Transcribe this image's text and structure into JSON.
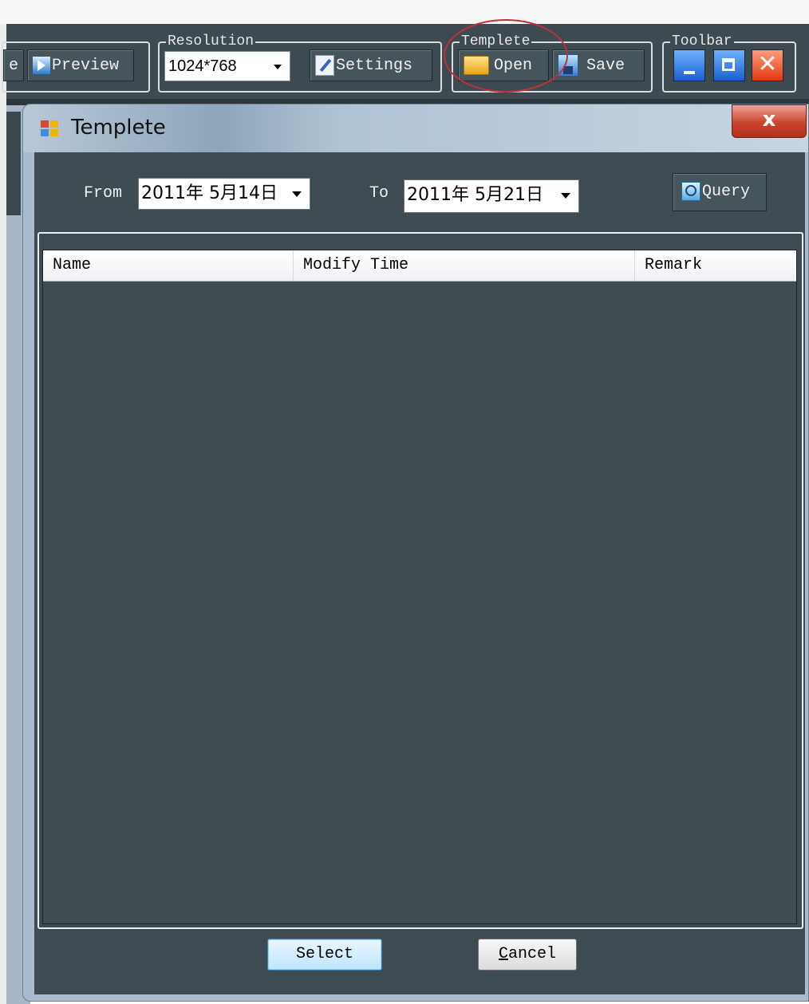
{
  "toolbar": {
    "partial_label": "e",
    "preview_label": "Preview",
    "resolution": {
      "title": "Resolution",
      "selected": "1024*768",
      "settings_label": "Settings"
    },
    "template": {
      "title": "Templete",
      "open_label": "Open",
      "save_label": "Save"
    },
    "toolbar_group": {
      "title": "Toolbar",
      "close_glyph": "✕"
    }
  },
  "dialog": {
    "title": "Templete",
    "close_glyph": "x",
    "from_label": "From",
    "from_date": "2011年 5月14日",
    "to_label": "To",
    "to_date": "2011年 5月21日",
    "query_label": "Query",
    "columns": [
      "Name",
      "Modify Time",
      "Remark"
    ],
    "rows": [],
    "select_label": "Select",
    "cancel_label": "Cancel"
  },
  "colors": {
    "toolbar_bg": "#3d4a52",
    "dialog_body_bg": "#3f4b53",
    "highlight_ring": "#c0303a",
    "close_button": "#c9442e"
  },
  "icons": [
    "preview-icon",
    "settings-icon",
    "folder-open-icon",
    "save-icon",
    "minimize-icon",
    "maximize-icon",
    "close-icon",
    "template-icon",
    "query-icon",
    "dropdown-arrow-icon"
  ]
}
